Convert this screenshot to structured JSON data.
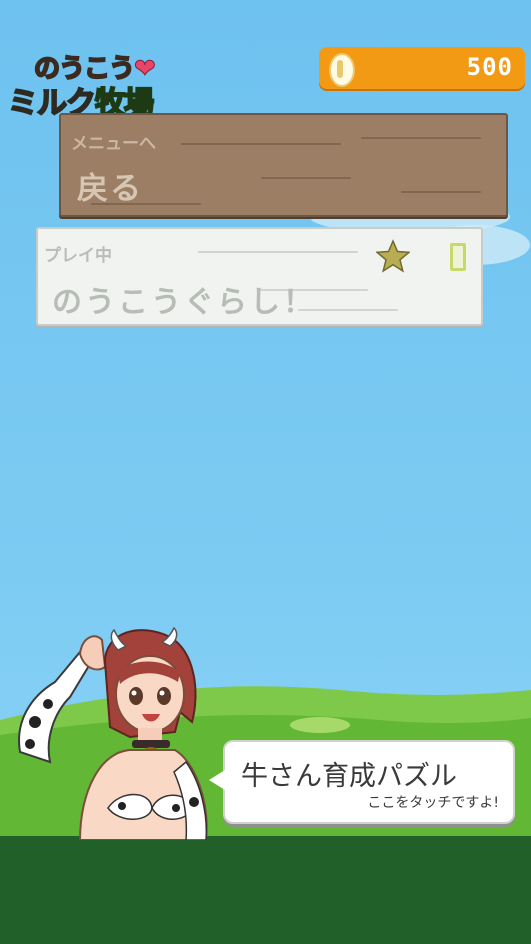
{
  "header": {
    "logo_line1": "のうこう",
    "logo_line2_a": "ミルク",
    "logo_line2_b": "牧場",
    "coins": "500",
    "coin_icon": "coin-icon"
  },
  "back_panel": {
    "small_label": "メニューへ",
    "big_label": "戻る"
  },
  "play_panel": {
    "small_label": "プレイ中",
    "big_label": "のうこうぐらし！",
    "star_icon": "star-icon",
    "battery_icon": "battery-icon"
  },
  "bubble": {
    "title": "牛さん育成パズル",
    "subtitle": "ここをタッチですよ!"
  },
  "colors": {
    "sky": "#7ccbf3",
    "grass": "#5fb935",
    "ground": "#22602a",
    "coin_bar": "#f39a14",
    "wood": "#9b7e63"
  }
}
